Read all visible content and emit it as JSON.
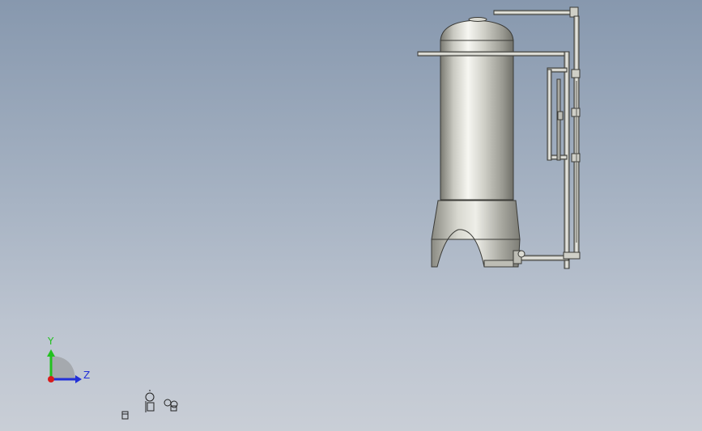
{
  "viewport": {
    "background_top": "#8798ae",
    "background_bottom": "#c9ced6",
    "model": "tank-assembly"
  },
  "triad": {
    "y_label": "Y",
    "z_label": "Z",
    "y_color": "#22c11f",
    "z_color": "#2230d8",
    "x_color": "#d81c1c"
  },
  "icons": {
    "view_icons": [
      "light-icon",
      "camera-icon",
      "scene-icon"
    ]
  }
}
